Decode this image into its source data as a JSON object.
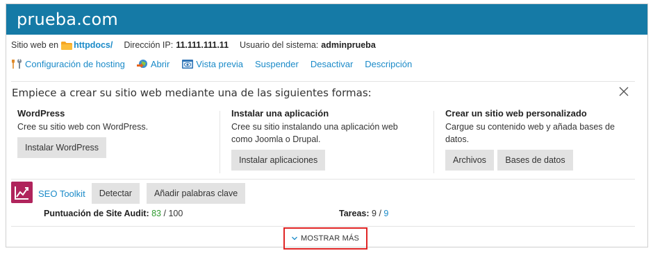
{
  "header": {
    "title": "prueba.com"
  },
  "info": {
    "site_label": "Sitio web en",
    "site_folder": "httpdocs/",
    "ip_label": "Dirección IP:",
    "ip_value": "11.111.111.11",
    "user_label": "Usuario del sistema:",
    "user_value": "adminprueba"
  },
  "actions": {
    "hosting": "Configuración de hosting",
    "open": "Abrir",
    "preview": "Vista previa",
    "suspend": "Suspender",
    "deactivate": "Desactivar",
    "description": "Descripción"
  },
  "start": {
    "title": "Empiece a crear su sitio web mediante una de las siguientes formas:",
    "columns": [
      {
        "title": "WordPress",
        "desc_lines": [
          "Cree su sitio web con WordPress."
        ],
        "buttons": [
          "Instalar WordPress"
        ]
      },
      {
        "title": "Instalar una aplicación",
        "desc_lines": [
          "Cree su sitio instalando una aplicación web",
          "como Joomla o Drupal."
        ],
        "buttons": [
          "Instalar aplicaciones"
        ]
      },
      {
        "title": "Crear un sitio web personalizado",
        "desc_lines": [
          "Cargue su contenido web y añada bases de",
          "datos."
        ],
        "buttons": [
          "Archivos",
          "Bases de datos"
        ]
      }
    ]
  },
  "seo": {
    "link": "SEO Toolkit",
    "detect": "Detectar",
    "keywords": "Añadir palabras clave",
    "audit_label": "Puntuación de Site Audit:",
    "audit_score": "83",
    "audit_total": "/ 100",
    "tasks_label": "Tareas:",
    "tasks_done": "9 /",
    "tasks_total": "9"
  },
  "more": {
    "label": "MOSTRAR MÁS"
  },
  "colors": {
    "header": "#157aa6",
    "link": "#1a8ac8",
    "seo_icon": "#b0245c",
    "highlight": "#e02424"
  }
}
